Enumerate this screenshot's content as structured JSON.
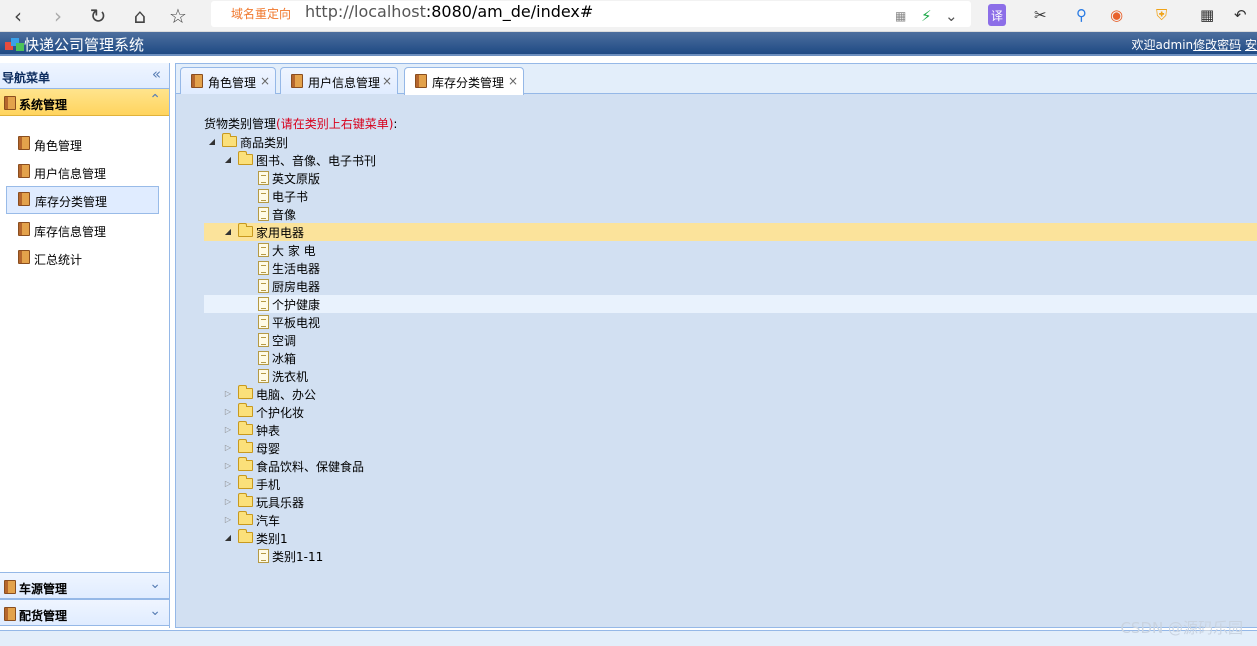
{
  "browser": {
    "url_badge": "域名重定向",
    "url_host": "http://localhost",
    "url_rest": ":8080/am_de/index#",
    "icons": [
      "back-arrow-icon",
      "forward-arrow-icon",
      "reload-icon",
      "home-icon",
      "star-icon"
    ],
    "translate_label": "译"
  },
  "app": {
    "title": "快递公司管理系统",
    "welcome": "欢迎admin",
    "change_password": "修改密码",
    "safe_exit": "安"
  },
  "nav": {
    "title": "导航菜单",
    "active_group": "系统管理",
    "items": [
      {
        "label": "角色管理"
      },
      {
        "label": "用户信息管理"
      },
      {
        "label": "库存分类管理"
      },
      {
        "label": "库存信息管理"
      },
      {
        "label": "汇总统计"
      }
    ],
    "bottom_groups": [
      {
        "label": "车源管理"
      },
      {
        "label": "配货管理"
      }
    ]
  },
  "tabs": [
    {
      "label": "角色管理",
      "close": "×"
    },
    {
      "label": "用户信息管理",
      "close": "×"
    },
    {
      "label": "库存分类管理",
      "close": "×"
    }
  ],
  "content": {
    "label_prefix": "货物类别管理",
    "label_hint": "(请在类别上右键菜单)",
    "label_suffix": ":"
  },
  "tree": [
    {
      "label": "商品类别",
      "level": 0,
      "type": "folder",
      "expanded": true
    },
    {
      "label": "图书、音像、电子书刊",
      "level": 1,
      "type": "folder",
      "expanded": true
    },
    {
      "label": "英文原版",
      "level": 2,
      "type": "leaf"
    },
    {
      "label": "电子书",
      "level": 2,
      "type": "leaf"
    },
    {
      "label": "音像",
      "level": 2,
      "type": "leaf"
    },
    {
      "label": "家用电器",
      "level": 1,
      "type": "folder",
      "expanded": true,
      "selected": true
    },
    {
      "label": "大 家 电",
      "level": 2,
      "type": "leaf"
    },
    {
      "label": "生活电器",
      "level": 2,
      "type": "leaf"
    },
    {
      "label": "厨房电器",
      "level": 2,
      "type": "leaf"
    },
    {
      "label": "个护健康",
      "level": 2,
      "type": "leaf",
      "hover": true
    },
    {
      "label": "平板电视",
      "level": 2,
      "type": "leaf"
    },
    {
      "label": "空调",
      "level": 2,
      "type": "leaf"
    },
    {
      "label": "冰箱",
      "level": 2,
      "type": "leaf"
    },
    {
      "label": "洗衣机",
      "level": 2,
      "type": "leaf"
    },
    {
      "label": "电脑、办公",
      "level": 1,
      "type": "folder",
      "expanded": false
    },
    {
      "label": "个护化妆",
      "level": 1,
      "type": "folder",
      "expanded": false
    },
    {
      "label": "钟表",
      "level": 1,
      "type": "folder",
      "expanded": false
    },
    {
      "label": "母婴",
      "level": 1,
      "type": "folder",
      "expanded": false
    },
    {
      "label": "食品饮料、保健食品",
      "level": 1,
      "type": "folder",
      "expanded": false
    },
    {
      "label": "手机",
      "level": 1,
      "type": "folder",
      "expanded": false
    },
    {
      "label": "玩具乐器",
      "level": 1,
      "type": "folder",
      "expanded": false
    },
    {
      "label": "汽车",
      "level": 1,
      "type": "folder",
      "expanded": false
    },
    {
      "label": "类别1",
      "level": 1,
      "type": "folder",
      "expanded": true
    },
    {
      "label": "类别1-11",
      "level": 2,
      "type": "leaf"
    }
  ],
  "watermark": "CSDN @源码乐园",
  "colors": {
    "header": "#1f4a84",
    "selected_row": "#fbe39b",
    "hint_red": "#d8001c",
    "panel_bg": "#d2e0f2"
  }
}
